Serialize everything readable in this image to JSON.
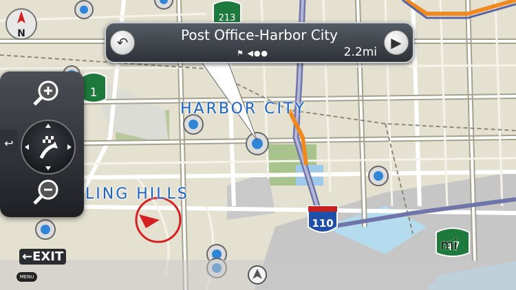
{
  "callout": {
    "title": "Post Office-Harbor City",
    "distance": "2.2mi"
  },
  "labels": {
    "harbor_city": "HARBOR CITY",
    "rolling_hills": "LING HILLS"
  },
  "shields": {
    "i110": "110",
    "ca1": "1",
    "ca213": "213",
    "ca47": "47"
  },
  "controls": {
    "exit": "EXIT",
    "menu": "MENU",
    "compass": "N"
  },
  "scale_unit": "mi",
  "icons": [
    "back-arrow-icon",
    "play-arrow-icon",
    "zoom-in-icon",
    "zoom-out-icon",
    "flag-icon",
    "compass-icon",
    "vehicle-arrow-icon",
    "poi-marker-icon"
  ]
}
